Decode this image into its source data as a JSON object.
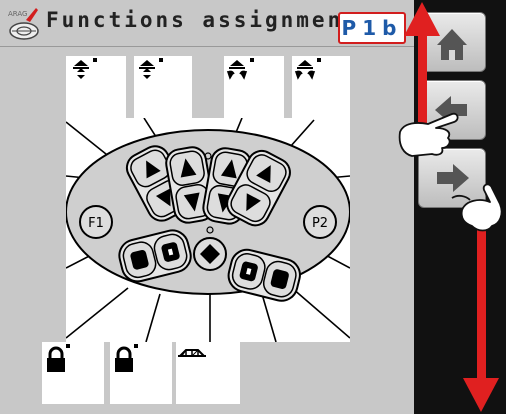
{
  "header": {
    "title": "Functions assignment",
    "program_badge": "P1b",
    "logo_text": "ARAG"
  },
  "top_slots": [
    {
      "icon": "raise-arrow-icon"
    },
    {
      "icon": "raise-arrow-icon"
    },
    {
      "icon": "tilt-arrows-icon"
    },
    {
      "icon": "tilt-arrows-icon"
    }
  ],
  "joystick": {
    "left_button_label": "F1",
    "right_button_label": "P2"
  },
  "bottom_slots": [
    {
      "icon": "lock-icon"
    },
    {
      "icon": "lock-icon"
    },
    {
      "icon": "boom-icon"
    }
  ],
  "nav": {
    "home_icon": "home-icon",
    "back_icon": "back-arrow-icon",
    "next_icon": "next-arrow-icon"
  },
  "colors": {
    "background": "#c8c8c8",
    "badge_border": "#d21e1e",
    "badge_text": "#1e5aa8",
    "annotation_arrow": "#e02020"
  }
}
